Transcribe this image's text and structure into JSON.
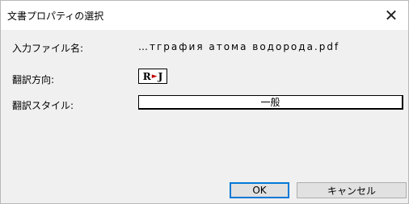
{
  "window": {
    "title": "文書プロパティの選択",
    "close_glyph": "✕"
  },
  "form": {
    "file_label": "入力ファイル名:",
    "file_value": "…тграфия атома водорода.pdf",
    "direction_label": "翻訳方向:",
    "direction_from": "R",
    "direction_arrow": "►",
    "direction_to": "J",
    "style_label": "翻訳スタイル:",
    "style_value": "一般"
  },
  "buttons": {
    "ok_label": "OK",
    "cancel_label": "キャンセル"
  }
}
